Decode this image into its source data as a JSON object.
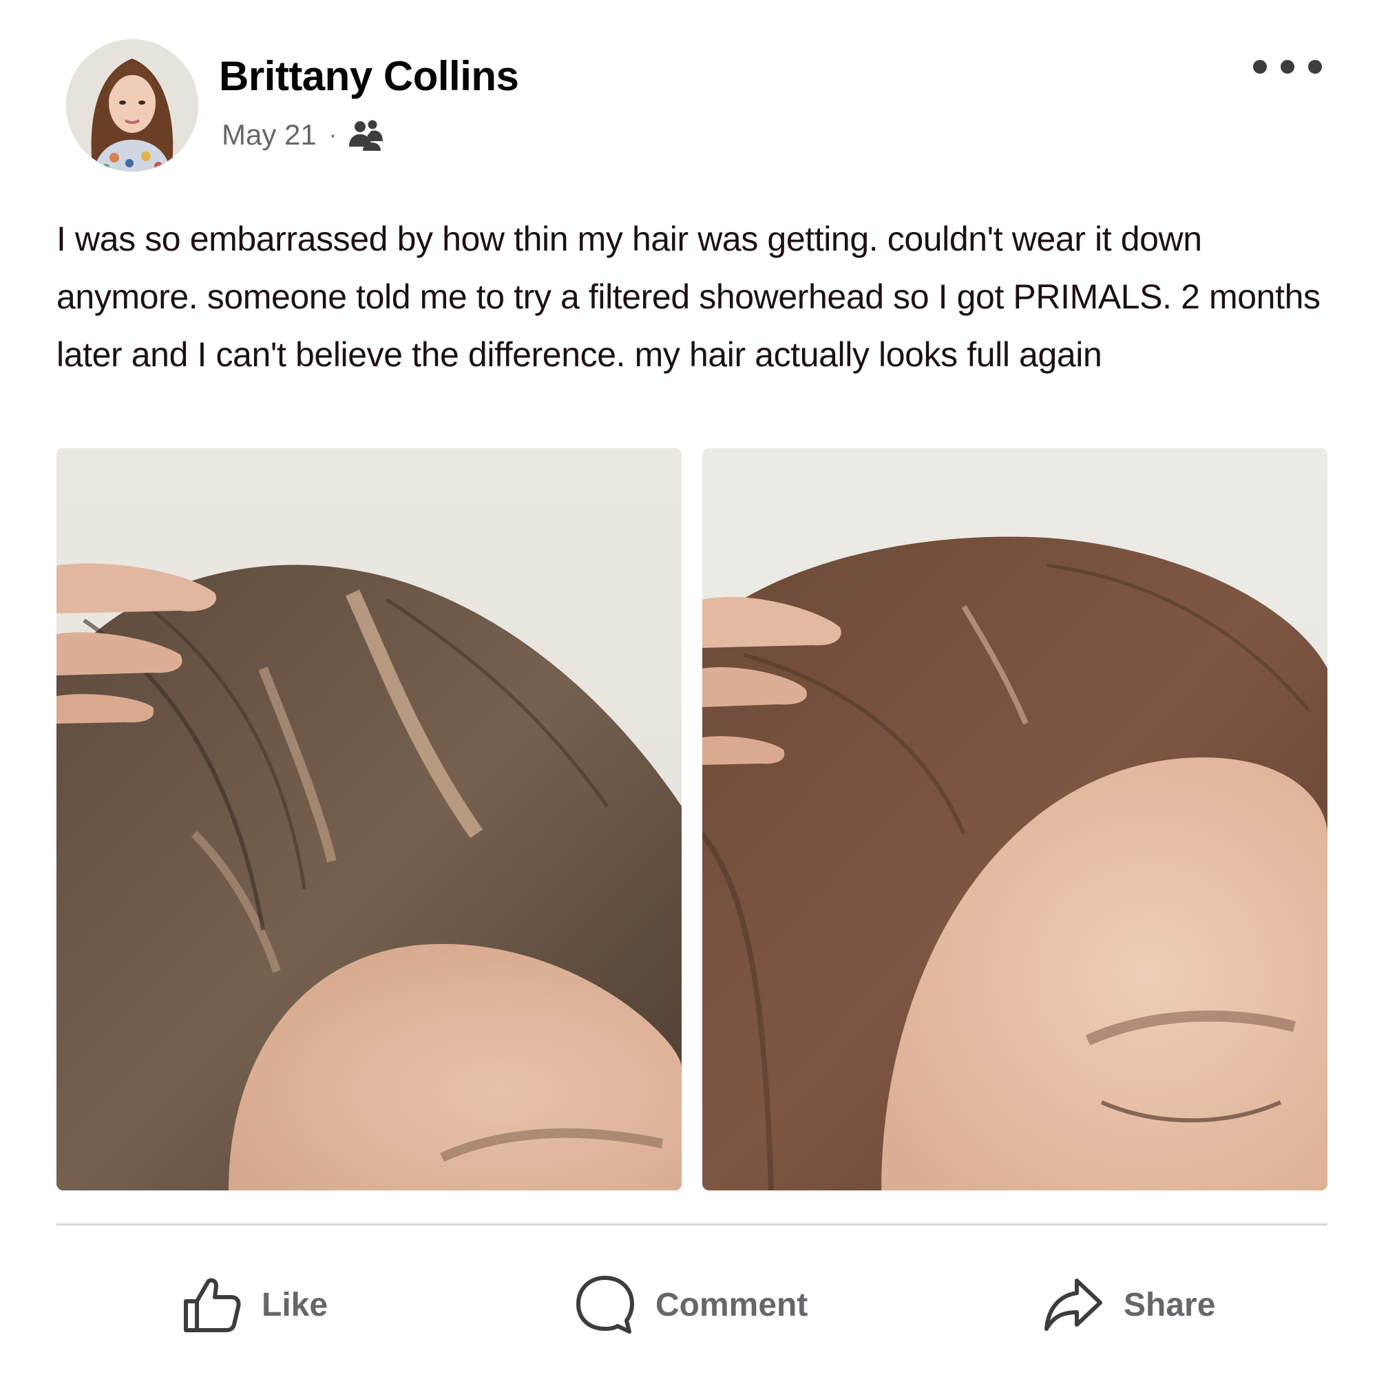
{
  "post": {
    "author": "Brittany Collins",
    "date": "May 21",
    "separator": "·",
    "audience_icon": "group-audience-icon",
    "more_icon": "more-options-icon",
    "text": "I was so embarrassed by how thin my hair was getting. couldn't wear it down anymore. someone told me to try a filtered showerhead so I got PRIMALS. 2 months later and I can't believe the difference. my hair actually looks full again",
    "photos": [
      "before-photo-thinning-hair",
      "after-photo-full-hair"
    ]
  },
  "actions": {
    "like_label": "Like",
    "comment_label": "Comment",
    "share_label": "Share"
  },
  "colors": {
    "name_text": "#050505",
    "meta_text": "#65676b",
    "body_text": "#1c1014",
    "divider": "#d6d6d6",
    "action_icon": "#3d3d40"
  }
}
